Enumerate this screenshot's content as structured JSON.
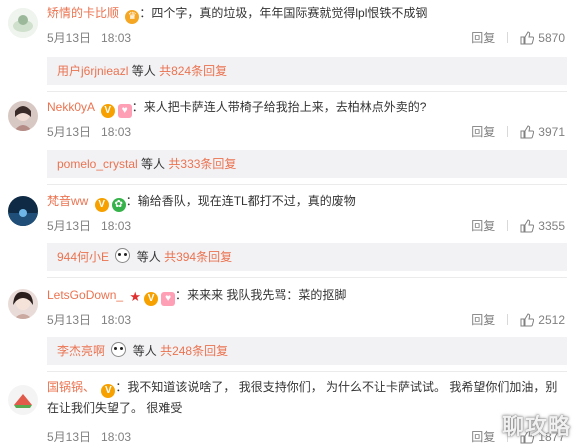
{
  "comments": [
    {
      "username": "矫情的卡比顺",
      "text": "四个字，真的垃圾，年年国际赛就觉得lpl恨铁不成钢",
      "date": "5月13日",
      "time": "18:03",
      "reply_label": "回复",
      "likes": "5870",
      "replies_summary": {
        "user": "用户j6rjnieazl",
        "etc": "等人",
        "total": "共824条回复"
      }
    },
    {
      "username": "Nekk0yA",
      "text": "来人把卡萨连人带椅子给我抬上来，去柏林点外卖的?",
      "date": "5月13日",
      "time": "18:03",
      "reply_label": "回复",
      "likes": "3971",
      "replies_summary": {
        "user": "pomelo_crystal",
        "etc": "等人",
        "total": "共333条回复"
      }
    },
    {
      "username": "梵音ww",
      "text": "输给香队，现在连TL都打不过，真的废物",
      "date": "5月13日",
      "time": "18:03",
      "reply_label": "回复",
      "likes": "3355",
      "replies_summary": {
        "user": "944何小E",
        "etc": "等人",
        "total": "共394条回复"
      }
    },
    {
      "username": "LetsGoDown_",
      "text": "来来来 我队我先骂：菜的抠脚",
      "date": "5月13日",
      "time": "18:03",
      "reply_label": "回复",
      "likes": "2512",
      "replies_summary": {
        "user": "李杰亮啊",
        "etc": "等人",
        "total": "共248条回复"
      }
    },
    {
      "username": "国锅锅、",
      "text": "我不知道该说啥了， 我很支持你们， 为什么不让卡萨试试。 我希望你们加油，别在让我们失望了。 很难受",
      "date": "5月13日",
      "time": "18:03",
      "reply_label": "回复",
      "likes": "1877"
    }
  ],
  "watermark": "聊攻略",
  "colors": {
    "username": "#eb7350",
    "reply_bg": "#f2f2f5",
    "meta": "#808080"
  }
}
